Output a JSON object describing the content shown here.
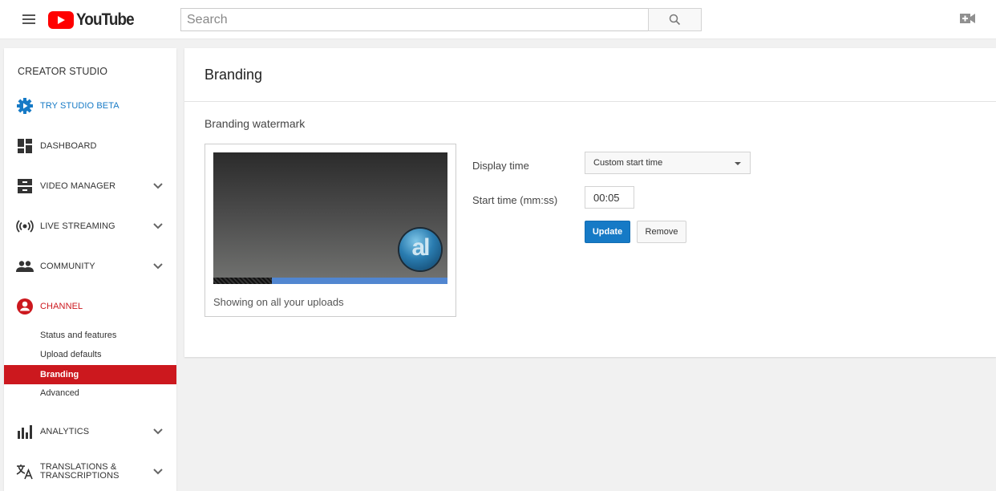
{
  "header": {
    "logo_text": "YouTube",
    "search_placeholder": "Search",
    "brand_color": "#ff0000"
  },
  "sidebar": {
    "title": "CREATOR STUDIO",
    "items": [
      {
        "label": "TRY STUDIO BETA",
        "icon": "gear-play-icon",
        "color": "#167ac6"
      },
      {
        "label": "DASHBOARD",
        "icon": "dashboard-icon"
      },
      {
        "label": "VIDEO MANAGER",
        "icon": "video-manager-icon",
        "expandable": true
      },
      {
        "label": "LIVE STREAMING",
        "icon": "live-streaming-icon",
        "expandable": true
      },
      {
        "label": "COMMUNITY",
        "icon": "community-icon",
        "expandable": true
      },
      {
        "label": "CHANNEL",
        "icon": "channel-icon",
        "color": "#cc181e"
      },
      {
        "label": "ANALYTICS",
        "icon": "analytics-icon",
        "expandable": true
      },
      {
        "label_line1": "TRANSLATIONS &",
        "label_line2": "TRANSCRIPTIONS",
        "icon": "translate-icon",
        "expandable": true
      }
    ],
    "channel_subitems": [
      {
        "label": "Status and features"
      },
      {
        "label": "Upload defaults"
      },
      {
        "label": "Branding",
        "active": true
      },
      {
        "label": "Advanced"
      }
    ],
    "active_color": "#cc181e"
  },
  "main": {
    "title": "Branding",
    "section_title": "Branding watermark",
    "preview": {
      "caption": "Showing on all your uploads",
      "watermark_text": "al",
      "progress_played_fraction": 0.25
    },
    "display_time": {
      "label": "Display time",
      "selected": "Custom start time"
    },
    "start_time": {
      "label": "Start time (mm:ss)",
      "value": "00:05"
    },
    "buttons": {
      "update": "Update",
      "remove": "Remove"
    },
    "accent_color": "#167ac6"
  }
}
